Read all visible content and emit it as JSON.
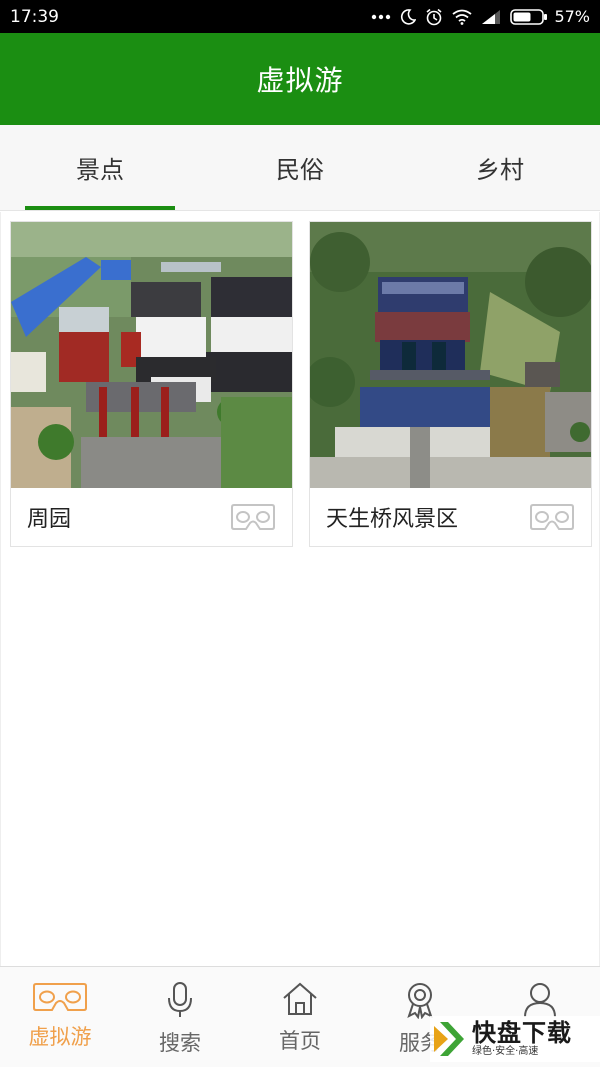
{
  "status_bar": {
    "time": "17:39",
    "battery": "57%"
  },
  "title_bar": {
    "title": "虚拟游"
  },
  "tabs": [
    {
      "label": "景点",
      "active": true
    },
    {
      "label": "民俗",
      "active": false
    },
    {
      "label": "乡村",
      "active": false
    }
  ],
  "cards": [
    {
      "label": "周园",
      "icon": "vr-glasses-icon"
    },
    {
      "label": "天生桥风景区",
      "icon": "vr-glasses-icon"
    }
  ],
  "bottom_nav": [
    {
      "label": "虚拟游",
      "icon": "vr-glasses-icon",
      "active": true
    },
    {
      "label": "搜索",
      "icon": "microphone-icon",
      "active": false
    },
    {
      "label": "首页",
      "icon": "home-icon",
      "active": false
    },
    {
      "label": "服务",
      "icon": "award-icon",
      "active": false
    },
    {
      "label": "",
      "icon": "user-icon",
      "active": false
    }
  ],
  "watermark": {
    "big": "快盘下载",
    "small": "绿色·安全·高速"
  },
  "colors": {
    "brand_green": "#1b8e12",
    "active_orange": "#f0a04b"
  }
}
